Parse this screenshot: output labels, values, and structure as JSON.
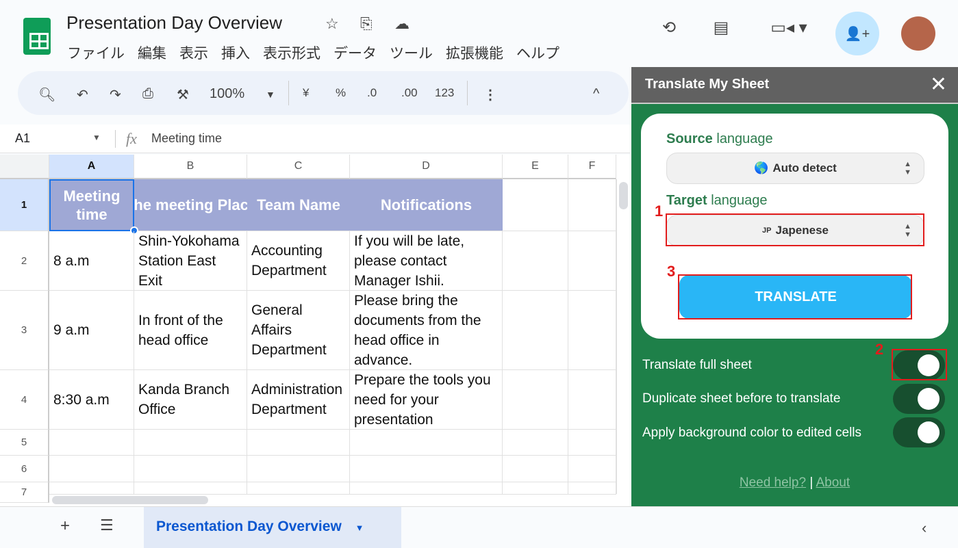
{
  "app": {
    "title": "Presentation Day Overview",
    "menu": [
      "ファイル",
      "編集",
      "表示",
      "挿入",
      "表示形式",
      "データ",
      "ツール",
      "拡張機能",
      "ヘルプ"
    ]
  },
  "toolbar": {
    "zoom": "100%",
    "currency": "¥",
    "percent": "%",
    "dec_decrease": ".0",
    "dec_increase": ".00",
    "format": "123"
  },
  "formula_bar": {
    "cell_ref": "A1",
    "fx": "fx",
    "value": "Meeting time"
  },
  "columns": [
    "A",
    "B",
    "C",
    "D",
    "E",
    "F"
  ],
  "rows": [
    "1",
    "2",
    "3",
    "4",
    "5",
    "6",
    "7"
  ],
  "table": {
    "header": [
      "Meeting time",
      "The meeting Place",
      "Team Name",
      "Notifications"
    ],
    "header_visible_b": "he meeting Plac",
    "data": [
      [
        "8 a.m",
        "Shin-Yokohama Station East Exit",
        "Accounting Department",
        "If you will be late, please contact Manager Ishii."
      ],
      [
        "9 a.m",
        "In front of the head office",
        "General Affairs Department",
        "Please bring the documents from the head office in advance."
      ],
      [
        "8:30 a.m",
        "Kanda Branch Office",
        "Administration Department",
        "Prepare the tools you need for your presentation"
      ]
    ]
  },
  "sheet_tab": "Presentation Day Overview",
  "sidebar": {
    "title": "Translate My Sheet",
    "source_label_bold": "Source",
    "source_label_rest": " language",
    "source_value": "Auto detect",
    "source_icon": "🌎",
    "target_label_bold": "Target",
    "target_label_rest": " language",
    "target_flag": "JP",
    "target_value": "Japenese",
    "translate_button": "TRANSLATE",
    "options": [
      {
        "label": "Translate full sheet",
        "on": true
      },
      {
        "label": "Duplicate sheet before to translate",
        "on": true
      },
      {
        "label": "Apply background color to edited cells",
        "on": true
      }
    ],
    "help_link": "Need help?",
    "separator": "|",
    "about_link": "About",
    "annotations": [
      "1",
      "2",
      "3"
    ]
  },
  "colors": {
    "header_fill": "#9fa8d5",
    "sidebar_green": "#1e8049",
    "button_blue": "#29b6f6",
    "annotation_red": "#e21c1c"
  }
}
